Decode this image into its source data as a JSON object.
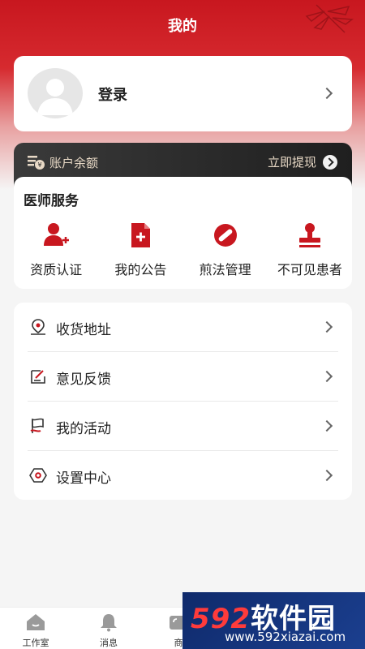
{
  "header": {
    "title": "我的"
  },
  "login": {
    "label": "登录"
  },
  "balance": {
    "label": "账户余额",
    "withdraw_label": "立即提现"
  },
  "services": {
    "title": "医师服务",
    "items": [
      {
        "label": "资质认证",
        "icon": "user-add-icon"
      },
      {
        "label": "我的公告",
        "icon": "document-plus-icon"
      },
      {
        "label": "煎法管理",
        "icon": "pill-icon"
      },
      {
        "label": "不可见患者",
        "icon": "stamp-icon"
      }
    ]
  },
  "menu": {
    "items": [
      {
        "label": "收货地址",
        "icon": "location-pin-icon"
      },
      {
        "label": "意见反馈",
        "icon": "feedback-edit-icon"
      },
      {
        "label": "我的活动",
        "icon": "activity-flag-icon"
      },
      {
        "label": "设置中心",
        "icon": "settings-hexagon-icon"
      }
    ]
  },
  "tabbar": {
    "items": [
      {
        "label": "工作室",
        "icon": "home-icon"
      },
      {
        "label": "消息",
        "icon": "bell-icon"
      },
      {
        "label": "商",
        "icon": "phone-icon"
      }
    ]
  },
  "watermark": {
    "logo_num": "592",
    "logo_text": "软件园",
    "url": "www.592xiazai.com"
  },
  "colors": {
    "accent": "#c8171f",
    "dark_card": "#2a2a2a",
    "gold_text": "#e8d9c6"
  }
}
